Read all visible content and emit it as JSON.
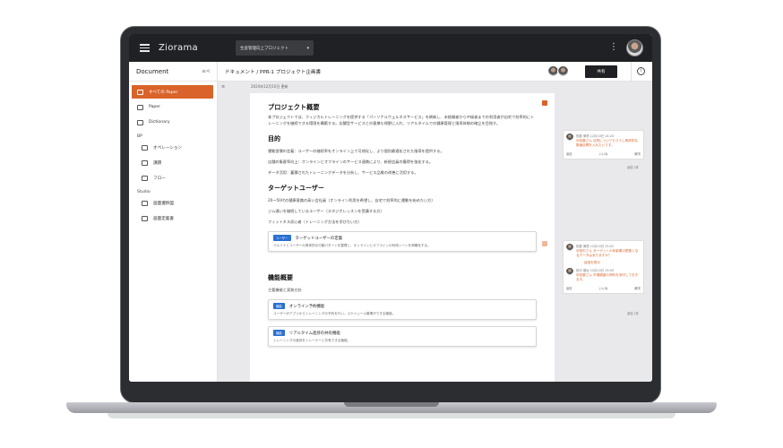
{
  "app": {
    "brand": "Ziorama",
    "project_select": "生産管理向上プロジェクト",
    "project_caret": "▾",
    "kebab": "⋮"
  },
  "sidebar": {
    "title": "Document",
    "collapse_icon": "≡<",
    "items": [
      {
        "label": "すべての Paper",
        "icon": "document-icon",
        "active": true
      },
      {
        "label": "Paper",
        "icon": "paper-icon"
      },
      {
        "label": "Dictionary",
        "icon": "dictionary-icon"
      }
    ],
    "section_bp": "BP",
    "bp_items": [
      {
        "label": "オペレーション",
        "icon": "person-icon"
      },
      {
        "label": "課題",
        "icon": "issue-icon"
      },
      {
        "label": "フロー",
        "icon": "flow-icon"
      }
    ],
    "section_studio": "Studio",
    "studio_items": [
      {
        "label": "画面遷移図",
        "icon": "screen-flow-icon"
      },
      {
        "label": "画面定義書",
        "icon": "screen-def-icon"
      }
    ]
  },
  "doc": {
    "breadcrumb": "ドキュメント / PPR-1 プロジェクト企画書",
    "share_label": "共有",
    "info_icon": "i",
    "gutter_icon": "≡",
    "date": "2024年12月10日 更新",
    "sections": {
      "overview_title": "プロジェクト概要",
      "overview_text": "本プロジェクトでは、フィジカルトレーニングを提供する「パーソナルウェルネスサービス」を刷新し、未経験者から中級者までの利用者が自宅で効率的にトレーニングを継続できる環境を構築する。店舗型サービスとの連携も視野に入れ、リアルタイムでの健康管理と指導体制の確立を目指す。",
      "purpose_title": "目的",
      "purpose_lines": [
        "運動習慣の定着：ユーザーの継続率をオンライン上で可視化し、より個別最適化された指導を提供する。",
        "店舗の集客率向上：オンラインとオフラインのサービス連携により、新規会員の獲得を強化する。",
        "データ活用：蓄積されたトレーニングデータを分析し、サービス品質の改善に活用する。"
      ],
      "target_title": "ターゲットユーザー",
      "target_lines": [
        "20〜50代の健康意識の高い会社員（オンライン利用を希望し、自宅で効率的に運動を始めたい方）",
        "ジム通いを継続しているユーザー（スタジオレッスンを受講する方）",
        "フィットネス初心者（トレーニング方法を学びたい方）"
      ],
      "target_card": {
        "chip": "ユーザー",
        "title": "ターゲットユーザーの定義",
        "desc": "ペルソナとユーザーの具体的な行動パターンを整理し、オンラインとオフラインの利用シーンを明確化する。"
      },
      "features_title": "機能概要",
      "features_sub": "主要機能と実装方針",
      "feature_cards": [
        {
          "chip": "機能",
          "title": "オンライン予約機能",
          "desc": "ユーザーがアプリからトレーニングの予約を行い、スケジュール管理ができる機能。"
        },
        {
          "chip": "機能",
          "title": "リアルタイム進捗の共有機能",
          "desc": "トレーニングの進捗をトレーナーと共有できる機能。"
        }
      ]
    }
  },
  "comments": [
    {
      "author": "佐藤 美咲",
      "time": "12月10日 14:20",
      "text": "@佐藤さん 目的についてもう少し具体的な数値目標を入れたいです。",
      "actions": [
        "返信",
        "いいね",
        "解決"
      ]
    },
    {
      "author": "佐藤 美咲",
      "time": "12月10日 15:02",
      "text": "@田中さん ターゲットの年齢層の根拠となるデータはありますか？",
      "link": "返信を表示"
    },
    {
      "author": "田中 健太",
      "time": "12月10日 15:45",
      "text": "@佐藤さん 市場調査の資料を添付しておきます。",
      "actions": [
        "返信",
        "いいね",
        "解決"
      ]
    }
  ],
  "comment_footers": [
    "返信 2件",
    "返信 1件"
  ],
  "colors": {
    "accent": "#d9632a",
    "accent_light": "#f0b89a",
    "chip": "#2a6fd1",
    "topbar": "#202124"
  }
}
